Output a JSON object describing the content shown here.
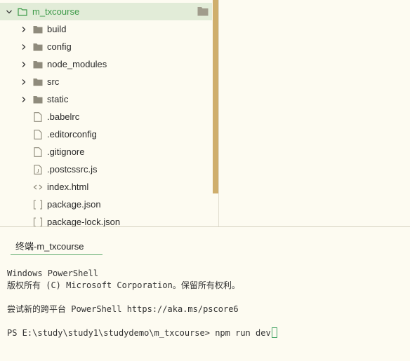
{
  "explorer": {
    "root": {
      "label": "m_txcourse",
      "expanded": true
    },
    "items": [
      {
        "label": "build",
        "type": "folder",
        "icon": "folder-icon"
      },
      {
        "label": "config",
        "type": "folder",
        "icon": "folder-icon"
      },
      {
        "label": "node_modules",
        "type": "folder",
        "icon": "folder-icon"
      },
      {
        "label": "src",
        "type": "folder",
        "icon": "folder-icon"
      },
      {
        "label": "static",
        "type": "folder",
        "icon": "folder-icon"
      },
      {
        "label": ".babelrc",
        "type": "file",
        "icon": "file-icon"
      },
      {
        "label": ".editorconfig",
        "type": "file",
        "icon": "file-icon"
      },
      {
        "label": ".gitignore",
        "type": "file",
        "icon": "file-icon"
      },
      {
        "label": ".postcssrc.js",
        "type": "file",
        "icon": "js-file-icon"
      },
      {
        "label": "index.html",
        "type": "file",
        "icon": "html-file-icon"
      },
      {
        "label": "package.json",
        "type": "file",
        "icon": "json-file-icon"
      },
      {
        "label": "package-lock.json",
        "type": "file",
        "icon": "json-file-icon"
      }
    ]
  },
  "terminal": {
    "tab_label": "终端-m_txcourse",
    "lines": [
      "Windows PowerShell",
      "版权所有 (C) Microsoft Corporation。保留所有权利。",
      "",
      "尝试新的跨平台 PowerShell https://aka.ms/pscore6",
      "",
      "PS E:\\study\\study1\\studydemo\\m_txcourse> npm run dev"
    ]
  },
  "colors": {
    "background": "#fdfbf1",
    "root_highlight": "#e2ecd8",
    "root_text": "#3c9a48",
    "scrollbar": "#cfae6c",
    "tab_underline": "#5aa96a",
    "folder": "#8f8b7c"
  }
}
